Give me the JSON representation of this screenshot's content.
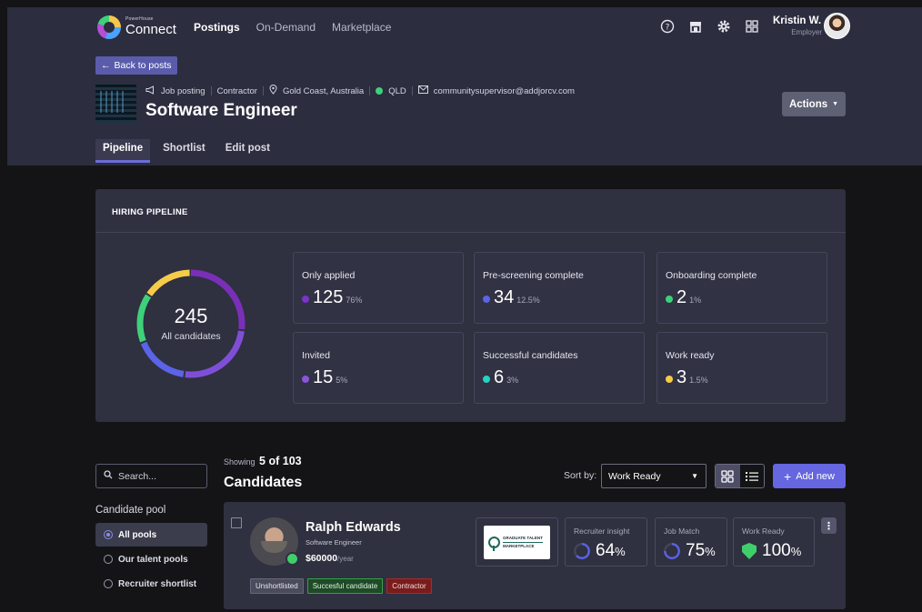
{
  "brand": {
    "small": "PowerHouse",
    "name": "Connect"
  },
  "nav": {
    "items": [
      "Postings",
      "On-Demand",
      "Marketplace"
    ],
    "active": 0
  },
  "user": {
    "name": "Kristin W.",
    "role": "Employer"
  },
  "posting": {
    "back_label": "Back to posts",
    "type": "Job posting",
    "contract": "Contractor",
    "location": "Gold Coast, Australia",
    "state": "QLD",
    "email": "communitysupervisor@addjorcv.com",
    "title": "Software Engineer",
    "actions_label": "Actions"
  },
  "tabs": [
    "Pipeline",
    "Shortlist",
    "Edit post"
  ],
  "pipeline": {
    "title": "HIRING PIPELINE",
    "total": "245",
    "total_label": "All candidates",
    "stats": [
      {
        "label": "Only applied",
        "value": "125",
        "pct": "76%",
        "color": "#7b33c9"
      },
      {
        "label": "Pre-screening complete",
        "value": "34",
        "pct": "12.5%",
        "color": "#5b63e6"
      },
      {
        "label": "Onboarding complete",
        "value": "2",
        "pct": "1%",
        "color": "#3fd07a"
      },
      {
        "label": "Invited",
        "value": "15",
        "pct": "5%",
        "color": "#8a55d8"
      },
      {
        "label": "Successful candidates",
        "value": "6",
        "pct": "3%",
        "color": "#25d3c2"
      },
      {
        "label": "Work ready",
        "value": "3",
        "pct": "1.5%",
        "color": "#f5cc4a"
      }
    ]
  },
  "filters": {
    "search_placeholder": "Search...",
    "pool_title": "Candidate pool",
    "pools": [
      "All pools",
      "Our talent pools",
      "Recruiter shortlist"
    ],
    "active_pool": 0
  },
  "list": {
    "showing_label": "Showing",
    "showing_count": "5 of 103",
    "title": "Candidates",
    "sort_label": "Sort by:",
    "sort_value": "Work Ready",
    "add_label": "Add new"
  },
  "candidate": {
    "name": "Ralph Edwards",
    "role": "Software Engineer",
    "salary": "$60000",
    "salary_unit": "/year",
    "tags": [
      "Unshortlisted",
      "Succesful candidate",
      "Contractor"
    ],
    "partner_logo": {
      "line1": "GRADUATE TALENT",
      "line2": "MARKETPLACE"
    },
    "metrics": [
      {
        "label": "Recruiter insight",
        "value": "64",
        "unit": "%",
        "icon": "progress-ring-icon"
      },
      {
        "label": "Job Match",
        "value": "75",
        "unit": "%",
        "icon": "progress-ring-icon"
      },
      {
        "label": "Work Ready",
        "value": "100",
        "unit": "%",
        "icon": "shield-icon"
      }
    ]
  },
  "colors": {
    "accent": "#6566e0",
    "header_bg": "#2c2d3f",
    "panel_bg": "#2f3040"
  }
}
